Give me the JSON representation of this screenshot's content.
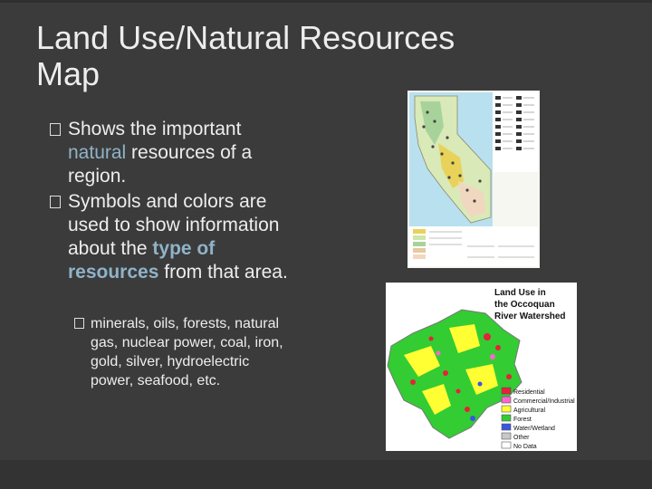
{
  "slide": {
    "title_line1": "Land Use/Natural Resources",
    "title_line2": "Map",
    "bullet1_pre": "Shows the important ",
    "bullet1_hl": "natural",
    "bullet1_post": " resources of a region.",
    "bullet2_pre": "Symbols and colors are used to show information about the ",
    "bullet2_hl": "type of resources",
    "bullet2_post": " from that area.",
    "sub_bullet": "minerals, oils, forests, natural gas, nuclear power, coal, iron, gold, silver, hydroelectric power, seafood, etc."
  },
  "map2": {
    "title_line1": "Land Use in",
    "title_line2": "the Occoquan",
    "title_line3": "River Watershed",
    "legend": [
      {
        "label": "Residential",
        "color": "#e8203a"
      },
      {
        "label": "Commercial/Industrial",
        "color": "#ff66cc"
      },
      {
        "label": "Agricultural",
        "color": "#ffff33"
      },
      {
        "label": "Forest",
        "color": "#33cc33"
      },
      {
        "label": "Water/Wetland",
        "color": "#3a55e0"
      },
      {
        "label": "Other",
        "color": "#c8c8c8"
      },
      {
        "label": "No Data",
        "color": "#ffffff"
      }
    ]
  },
  "map1": {
    "legend_colors": [
      "#e8d25a",
      "#cfe6a8",
      "#a7d39a",
      "#e9c9a0",
      "#f1d7c0"
    ]
  }
}
